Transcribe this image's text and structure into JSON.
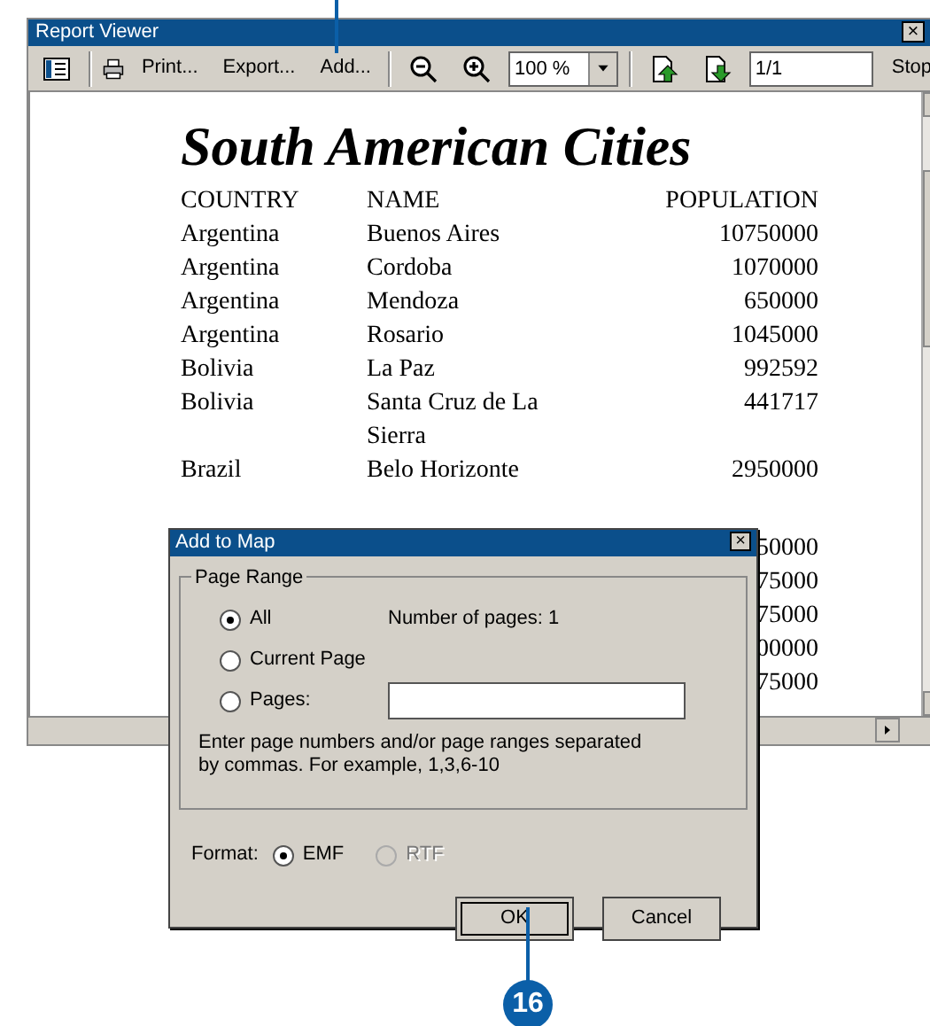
{
  "window": {
    "title": "Report Viewer",
    "close": "×"
  },
  "toolbar": {
    "buttons": [
      {
        "kind": "icon"
      },
      {
        "kind": "text",
        "label": "Print..."
      },
      {
        "kind": "text",
        "label": "Export..."
      },
      {
        "kind": "text",
        "label": "Add..."
      },
      {
        "kind": "icon"
      },
      {
        "kind": "icon"
      },
      {
        "kind": "combo",
        "value": "100 %"
      },
      {
        "kind": "icon"
      },
      {
        "kind": "icon"
      },
      {
        "kind": "field",
        "value": "1/1"
      },
      {
        "kind": "text",
        "label": "Stop"
      }
    ]
  },
  "report": {
    "title": "South American Cities",
    "columns": [
      "COUNTRY",
      "NAME",
      "POPULATION"
    ],
    "rows": [
      [
        "Argentina",
        "Buenos Aires",
        "10750000"
      ],
      [
        "Argentina",
        "Cordoba",
        "1070000"
      ],
      [
        "Argentina",
        "Mendoza",
        "650000"
      ],
      [
        "Argentina",
        "Rosario",
        "1045000"
      ],
      [
        "Bolivia",
        "La Paz",
        "992592"
      ],
      [
        "Bolivia",
        "Santa Cruz de La Sierra",
        "441717"
      ],
      [
        "Brazil",
        "Belo Horizonte",
        "2950000"
      ]
    ],
    "obscured_values": [
      "50000",
      "75000",
      "75000",
      "00000",
      "75000"
    ]
  },
  "dialog": {
    "title": "Add to Map",
    "close": "×",
    "group": "Page Range",
    "options": [
      {
        "label": "All",
        "selected": true
      },
      {
        "label": "Current Page",
        "selected": false
      },
      {
        "label": "Pages:",
        "selected": false
      }
    ],
    "page_count": "Number of pages: 1",
    "hint": "Enter page numbers and/or page ranges separated by commas. For example, 1,3,6-10",
    "format_label": "Format:",
    "formats": [
      {
        "label": "EMF",
        "selected": true,
        "disabled": false
      },
      {
        "label": "RTF",
        "selected": false,
        "disabled": true
      }
    ],
    "buttons": [
      {
        "label": "OK",
        "focused": true
      },
      {
        "label": "Cancel",
        "focused": false
      }
    ]
  },
  "callout": {
    "number": "16"
  }
}
